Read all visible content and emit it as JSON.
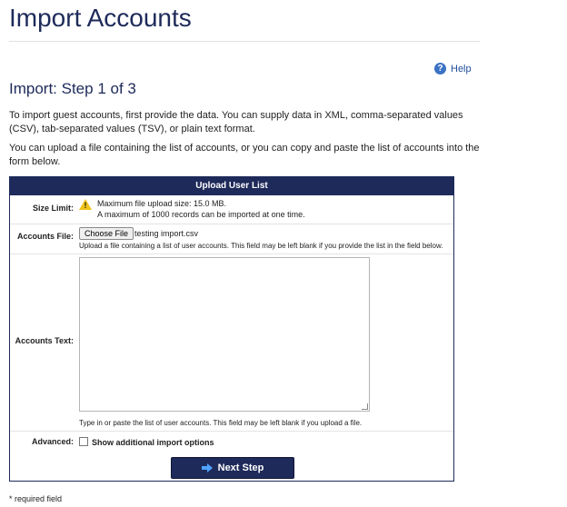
{
  "page": {
    "title": "Import Accounts",
    "help_label": "Help",
    "step_title": "Import: Step 1 of 3",
    "intro_1": "To import guest accounts, first provide the data. You can supply data in XML, comma-separated values (CSV), tab-separated values (TSV), or plain text format.",
    "intro_2": "You can upload a file containing the list of accounts, or you can copy and paste the list of accounts into the form below.",
    "required_mark": "*",
    "required_note": "required field"
  },
  "form": {
    "header": "Upload User List",
    "size_limit": {
      "label": "Size Limit:",
      "line1": "Maximum file upload size: 15.0 MB.",
      "line2": "A maximum of 1000 records can be imported at one time."
    },
    "accounts_file": {
      "label": "Accounts File:",
      "button": "Choose File",
      "filename": "testing import.csv",
      "hint": "Upload a file containing a list of user accounts. This field may be left blank if you provide the list in the field below."
    },
    "accounts_text": {
      "label": "Accounts Text:",
      "value": "",
      "hint": "Type in or paste the list of user accounts. This field may be left blank if you upload a file."
    },
    "advanced": {
      "label": "Advanced:",
      "checkbox_label": "Show additional import options",
      "checked": false
    },
    "next_button": "Next Step"
  },
  "colors": {
    "navy": "#1e2a5a",
    "link": "#1f4e9c",
    "warning": "#f0c419"
  }
}
